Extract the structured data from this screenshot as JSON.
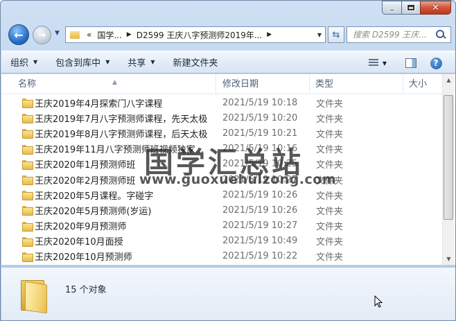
{
  "window": {
    "minimize_symbol": "",
    "maximize_symbol": "",
    "close_symbol": "✕"
  },
  "nav": {
    "back_symbol": "←",
    "forward_symbol": "→",
    "address": {
      "prefix": "«",
      "parts": [
        "国学...",
        "D2599 王庆八字预测师2019年..."
      ],
      "separator": "▶"
    },
    "search_placeholder": "搜索 D2599 王庆..."
  },
  "toolbar": {
    "organize": "组织",
    "include_in_library": "包含到库中",
    "share": "共享",
    "new_folder": "新建文件夹"
  },
  "columns": {
    "name": "名称",
    "date_modified": "修改日期",
    "type": "类型",
    "size": "大小"
  },
  "files": [
    {
      "name": "王庆2019年4月探索门八字课程",
      "date": "2021/5/19 10:18",
      "type": "文件夹"
    },
    {
      "name": "王庆2019年7月八字预测师课程，先天太极",
      "date": "2021/5/19 10:20",
      "type": "文件夹"
    },
    {
      "name": "王庆2019年8月八字预测师课程，后天太极",
      "date": "2021/5/19 10:21",
      "type": "文件夹"
    },
    {
      "name": "王庆2019年11月八字预测师班视频独家...",
      "date": "2021/5/19 10:16",
      "type": "文件夹"
    },
    {
      "name": "王庆2020年1月预测师班",
      "date": "2021/5/19 10:25",
      "type": "文件夹"
    },
    {
      "name": "王庆2020年2月预测师班",
      "date": "2021/5/19 10:27",
      "type": "文件夹"
    },
    {
      "name": "王庆2020年5月课程。字碰字",
      "date": "2021/5/19 10:26",
      "type": "文件夹"
    },
    {
      "name": "王庆2020年5月预测师(岁运)",
      "date": "2021/5/19 10:26",
      "type": "文件夹"
    },
    {
      "name": "王庆2020年9月预测师",
      "date": "2021/5/19 10:27",
      "type": "文件夹"
    },
    {
      "name": "王庆2020年10月面授",
      "date": "2021/5/19 10:49",
      "type": "文件夹"
    },
    {
      "name": "王庆2020年10月预测师",
      "date": "2021/5/19 10:22",
      "type": "文件夹"
    }
  ],
  "watermark": {
    "title": "国学汇总站",
    "url": "www.guoxuehuizong.com"
  },
  "details": {
    "count_text": "15 个对象"
  }
}
